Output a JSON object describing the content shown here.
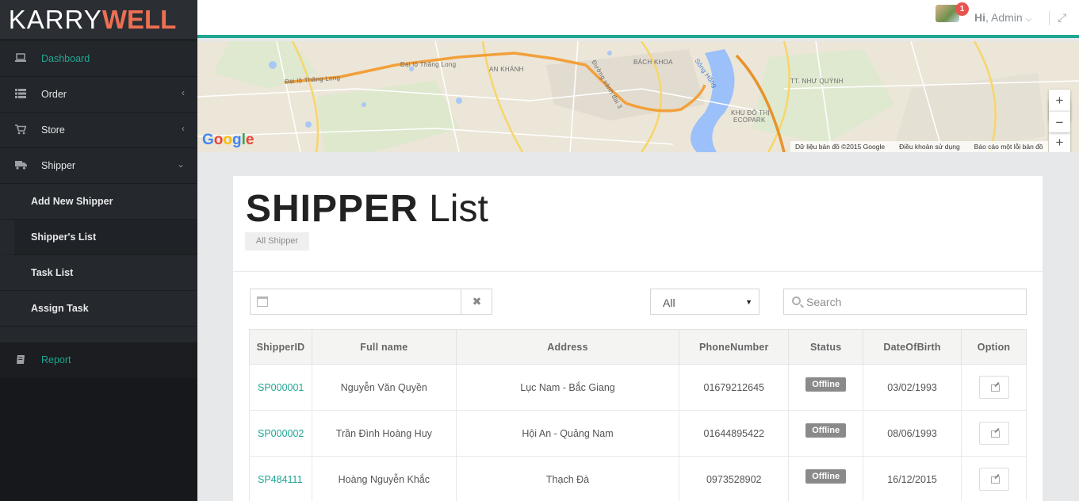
{
  "brand": {
    "part1": "KARRY",
    "part2": "WELL"
  },
  "sidebar": {
    "items": [
      {
        "label": "Dashboard",
        "icon": "laptop-icon"
      },
      {
        "label": "Order",
        "icon": "list-icon"
      },
      {
        "label": "Store",
        "icon": "cart-icon"
      },
      {
        "label": "Shipper",
        "icon": "truck-icon"
      }
    ],
    "shipper_submenu": [
      "Add New Shipper",
      "Shipper's List",
      "Task List",
      "Assign Task"
    ],
    "report": {
      "label": "Report",
      "icon": "book-icon"
    }
  },
  "topbar": {
    "notification_count": "1",
    "greeting_hi": "Hi",
    "greeting_name": ", Admin"
  },
  "map": {
    "labels": [
      "Đại lộ Thăng Long",
      "Đại lộ Thăng Long",
      "AN KHÁNH",
      "BÁCH KHOA",
      "Đường vành đai 3",
      "Sông Hồng",
      "TT. NHƯ QUỲNH",
      "KHU ĐÔ THỊ",
      "ECOPARK"
    ],
    "google_logo": "Google",
    "attribution": [
      "Dữ liệu bản đồ ©2015 Google",
      "Điều khoản sử dụng",
      "Báo cáo một lỗi bản đồ"
    ],
    "zoom_in": "+",
    "zoom_out": "−"
  },
  "page": {
    "title_bold": "SHIPPER",
    "title_light": "List",
    "breadcrumb": "All Shipper"
  },
  "filters": {
    "date_clear": "✖",
    "status_select": "All",
    "search_placeholder": "Search"
  },
  "table": {
    "headers": [
      "ShipperID",
      "Full name",
      "Address",
      "PhoneNumber",
      "Status",
      "DateOfBirth",
      "Option"
    ],
    "rows": [
      {
        "id": "SP000001",
        "name": "Nguyễn Văn Quyền",
        "address": "Lục Nam - Bắc Giang",
        "phone": "01679212645",
        "status": "Offline",
        "dob": "03/02/1993"
      },
      {
        "id": "SP000002",
        "name": "Trần Đình Hoàng Huy",
        "address": "Hội An - Quảng Nam",
        "phone": "01644895422",
        "status": "Offline",
        "dob": "08/06/1993"
      },
      {
        "id": "SP484111",
        "name": "Hoàng Nguyễn Khắc",
        "address": "Thạch Đà",
        "phone": "0973528902",
        "status": "Offline",
        "dob": "16/12/2015"
      }
    ]
  },
  "colors": {
    "accent": "#1fa693",
    "brand_orange": "#ee6f52",
    "sidebar_bg": "#1d1f22"
  }
}
